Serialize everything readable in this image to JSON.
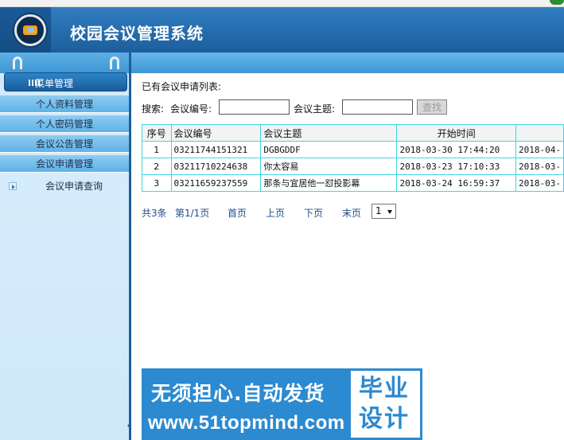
{
  "app": {
    "title": "校园会议管理系统"
  },
  "sidebar": {
    "header": "菜单管理",
    "items": [
      {
        "label": "个人资料管理"
      },
      {
        "label": "个人密码管理"
      },
      {
        "label": "会议公告管理"
      },
      {
        "label": "会议申请管理"
      }
    ],
    "subitems": [
      {
        "label": "会议申请查询"
      }
    ]
  },
  "main": {
    "caption": "已有会议申请列表:",
    "search": {
      "label": "搜索:",
      "field1_label": "会议编号:",
      "field1_value": "",
      "field2_label": "会议主题:",
      "field2_value": "",
      "button": "查找"
    },
    "table": {
      "columns": [
        "序号",
        "会议编号",
        "会议主题",
        "开始时间",
        ""
      ],
      "rows": [
        {
          "idx": "1",
          "code": "03211744151321",
          "topic": "DGBGDDF",
          "start": "2018-03-30 17:44:20",
          "end": "2018-04-"
        },
        {
          "idx": "2",
          "code": "03211710224638",
          "topic": "你太容易",
          "start": "2018-03-23 17:10:33",
          "end": "2018-03-"
        },
        {
          "idx": "3",
          "code": "03211659237559",
          "topic": "那条与宜居他一怼投影幕",
          "start": "2018-03-24 16:59:37",
          "end": "2018-03-"
        }
      ]
    },
    "pager": {
      "total": "共3条",
      "page": "第1/1页",
      "first": "首页",
      "prev": "上页",
      "next": "下页",
      "last": "末页",
      "select_value": "1"
    }
  },
  "banner": {
    "line1": "无须担心.自动发货",
    "line2": "www.51topmind.com",
    "right_line1": "毕业",
    "right_line2": "设计"
  },
  "colors": {
    "header": "#1d5e9d",
    "menu_item": "#5fb2e8",
    "table_border": "#3fd6e2",
    "banner": "#2c8ad0"
  }
}
